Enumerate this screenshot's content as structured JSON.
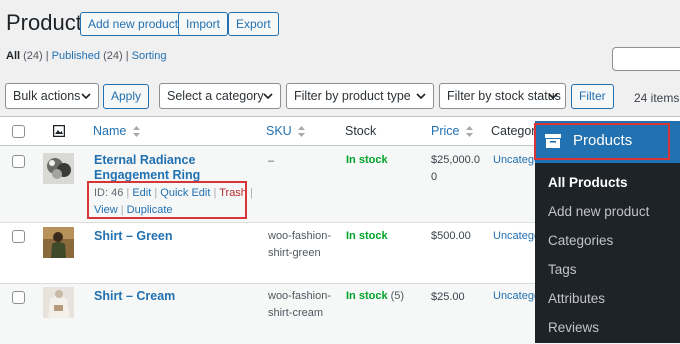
{
  "header": {
    "title": "Products",
    "add_new": "Add new product",
    "import": "Import",
    "export": "Export"
  },
  "filters_links": {
    "all": "All",
    "all_count": "(24)",
    "separator": "|",
    "published": "Published",
    "published_count": "(24)",
    "sorting": "Sorting"
  },
  "tablenav": {
    "bulk_actions": "Bulk actions",
    "apply": "Apply",
    "category": "Select a category",
    "product_type": "Filter by product type",
    "stock_status": "Filter by stock status",
    "filter": "Filter",
    "count": "24 items"
  },
  "columns": {
    "name": "Name",
    "sku": "SKU",
    "stock": "Stock",
    "price": "Price",
    "categories": "Categories"
  },
  "rows": [
    {
      "name": "Eternal Radiance Engagement Ring",
      "id_label": "ID: 46",
      "sep": "|",
      "edit": "Edit",
      "quick_edit": "Quick Edit",
      "trash": "Trash",
      "view": "View",
      "duplicate": "Duplicate",
      "sku": "–",
      "stock": "In stock",
      "price_line1": "$25,000.0",
      "price_line2": "0",
      "category": "Uncategorized"
    },
    {
      "name": "Shirt – Green",
      "sku_line1": "woo-fashion-",
      "sku_line2": "shirt-green",
      "stock": "In stock",
      "price": "$500.00",
      "category": "Uncategorized"
    },
    {
      "name": "Shirt – Cream",
      "sku_line1": "woo-fashion-",
      "sku_line2": "shirt-cream",
      "stock": "In stock",
      "stock_qty": "(5)",
      "price": "$25.00",
      "category": "Uncategorized"
    }
  ],
  "menu": {
    "title": "Products",
    "items": [
      "All Products",
      "Add new product",
      "Categories",
      "Tags",
      "Attributes",
      "Reviews"
    ]
  },
  "colors": {
    "accent": "#2271b1",
    "highlight": "#d63638",
    "in_stock": "#00a32a",
    "menu_bg": "#1d2327"
  }
}
